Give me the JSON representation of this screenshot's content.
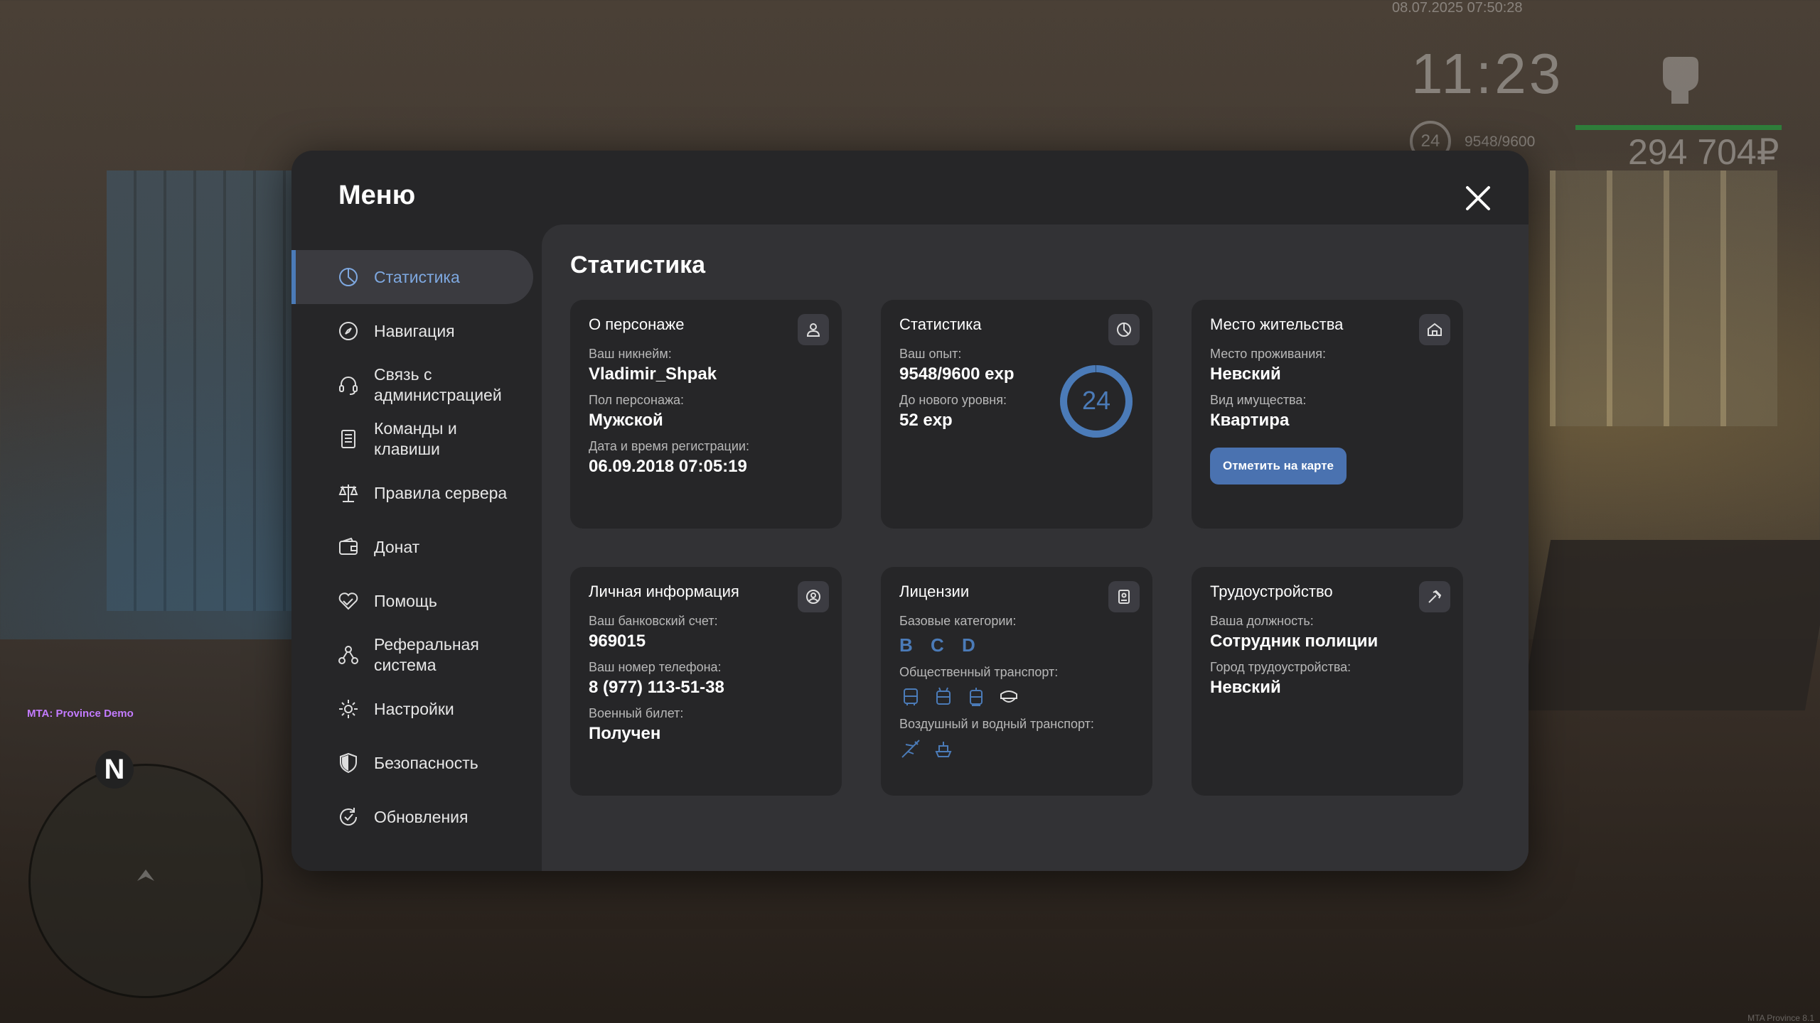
{
  "hud": {
    "datetime": "08.07.2025 07:50:28",
    "clock": "11:23",
    "level": "24",
    "exp": "9548/9600",
    "money": "294 704₽",
    "server_label": "MTA: Province Demo",
    "corner_label": "MTA Province 8.1",
    "radar_north": "N"
  },
  "menu": {
    "title": "Меню",
    "nav": [
      {
        "label": "Статистика",
        "icon": "stats-pie-icon",
        "active": true
      },
      {
        "label": "Навигация",
        "icon": "compass-icon"
      },
      {
        "label": "Связь с\nадминистрацией",
        "icon": "headset-icon"
      },
      {
        "label": "Команды и\nклавиши",
        "icon": "document-icon"
      },
      {
        "label": "Правила сервера",
        "icon": "scales-icon"
      },
      {
        "label": "Донат",
        "icon": "wallet-icon"
      },
      {
        "label": "Помощь",
        "icon": "heart-hand-icon"
      },
      {
        "label": "Реферальная\nсистема",
        "icon": "referral-icon"
      },
      {
        "label": "Настройки",
        "icon": "gear-icon"
      },
      {
        "label": "Безопасность",
        "icon": "shield-icon"
      },
      {
        "label": "Обновления",
        "icon": "refresh-check-icon"
      }
    ]
  },
  "stats": {
    "title": "Статистика",
    "character": {
      "title": "О персонаже",
      "nick_label": "Ваш никнейм:",
      "nick": "Vladimir_Shpak",
      "gender_label": "Пол персонажа:",
      "gender": "Мужской",
      "reg_label": "Дата и время регистрации:",
      "reg": "06.09.2018 07:05:19"
    },
    "statistics": {
      "title": "Статистика",
      "exp_label": "Ваш опыт:",
      "exp": "9548/9600 exp",
      "next_label": "До нового уровня:",
      "next": "52 exp",
      "level": "24",
      "progress": 0.9946
    },
    "residence": {
      "title": "Место жительства",
      "place_label": "Место проживания:",
      "place": "Невский",
      "property_label": "Вид имущества:",
      "property": "Квартира",
      "button": "Отметить на карте"
    },
    "personal": {
      "title": "Личная информация",
      "bank_label": "Ваш банковский счет:",
      "bank": "969015",
      "phone_label": "Ваш номер телефона:",
      "phone": "8 (977) 113-51-38",
      "military_label": "Военный билет:",
      "military": "Получен"
    },
    "licenses": {
      "title": "Лицензии",
      "base_label": "Базовые категории:",
      "base": [
        "B",
        "C",
        "D"
      ],
      "public_label": "Общественный транспорт:",
      "air_label": "Воздушный и водный транспорт:"
    },
    "employment": {
      "title": "Трудоустройство",
      "position_label": "Ваша должность:",
      "position": "Сотрудник полиции",
      "city_label": "Город трудоустройства:",
      "city": "Невский"
    }
  }
}
